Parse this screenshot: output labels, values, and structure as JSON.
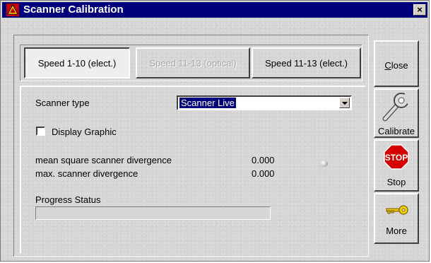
{
  "window": {
    "title": "Scanner Calibration",
    "close_glyph": "×"
  },
  "tabs": [
    {
      "label": "Speed 1-10 (elect.)",
      "state": "active"
    },
    {
      "label": "Speed 11-13 (optical)",
      "state": "disabled"
    },
    {
      "label": "Speed 11-13 (elect.)",
      "state": "normal"
    }
  ],
  "form": {
    "scanner_type_label": "Scanner type",
    "scanner_type_value": "Scanner Live",
    "display_graphic_label": "Display Graphic",
    "display_graphic_checked": false,
    "mean_label": "mean square scanner divergence",
    "mean_value": "0.000",
    "max_label": "max. scanner divergence",
    "max_value": "0.000",
    "progress_label": "Progress Status",
    "progress_fraction": 0
  },
  "side_buttons": {
    "close_label_hotkey": "C",
    "close_label_rest": "lose",
    "calibrate_label": "Calibrate",
    "stop_sign_text": "STOP",
    "stop_label": "Stop",
    "more_label": "More"
  },
  "icons": {
    "app": "calibration-app-icon",
    "calibrate": "wrench-icon",
    "stop": "stop-sign-icon",
    "more": "key-icon"
  }
}
